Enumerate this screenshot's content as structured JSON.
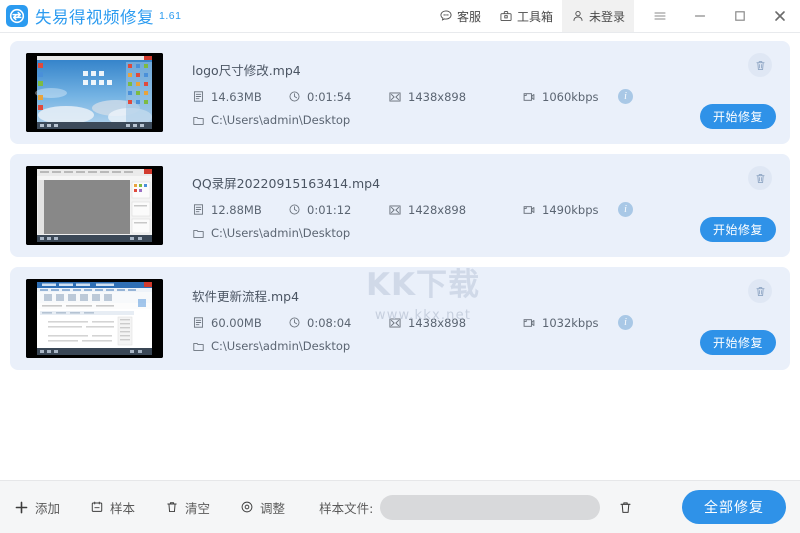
{
  "titlebar": {
    "logo_icon": "circular-arrow-logo",
    "app_name": "失易得视频修复",
    "version": "1.61",
    "actions": [
      {
        "icon": "chat-support-icon",
        "label": "客服",
        "highlight": false
      },
      {
        "icon": "toolbox-icon",
        "label": "工具箱",
        "highlight": false
      },
      {
        "icon": "user-icon",
        "label": "未登录",
        "highlight": true
      }
    ],
    "window_controls": [
      {
        "icon": "hamburger-menu-icon",
        "name": "menu"
      },
      {
        "icon": "minimize-icon",
        "name": "minimize"
      },
      {
        "icon": "maximize-icon",
        "name": "maximize"
      },
      {
        "icon": "close-icon",
        "name": "close"
      }
    ]
  },
  "watermark": {
    "main": "KK下载",
    "sub": "www.kkx.net"
  },
  "list": {
    "delete_icon": "trash-icon",
    "info_icon": "info-icon",
    "size_icon": "file-size-icon",
    "duration_icon": "clock-icon",
    "resolution_icon": "resolution-icon",
    "bitrate_icon": "video-bitrate-icon",
    "folder_icon": "folder-icon",
    "repair_label": "开始修复",
    "items": [
      {
        "filename": "logo尺寸修改.mp4",
        "size": "14.63MB",
        "duration": "0:01:54",
        "resolution": "1438x898",
        "bitrate": "1060kbps",
        "path": "C:\\Users\\admin\\Desktop",
        "thumb": "desktop-sky-wallpaper"
      },
      {
        "filename": "QQ录屏20220915163414.mp4",
        "size": "12.88MB",
        "duration": "0:01:12",
        "resolution": "1428x898",
        "bitrate": "1490kbps",
        "path": "C:\\Users\\admin\\Desktop",
        "thumb": "gray-application-window"
      },
      {
        "filename": "软件更新流程.mp4",
        "size": "60.00MB",
        "duration": "0:08:04",
        "resolution": "1438x898",
        "bitrate": "1032kbps",
        "path": "C:\\Users\\admin\\Desktop",
        "thumb": "document-editor-window"
      }
    ]
  },
  "footer": {
    "buttons": [
      {
        "icon": "plus-icon",
        "label": "添加"
      },
      {
        "icon": "sample-icon",
        "label": "样本"
      },
      {
        "icon": "trash-icon",
        "label": "清空"
      },
      {
        "icon": "adjust-icon",
        "label": "调整"
      }
    ],
    "sample_file_label": "样本文件:",
    "sample_file_value": "",
    "sample_file_placeholder": "",
    "sample_delete_icon": "trash-icon",
    "fix_all_label": "全部修复"
  },
  "colors": {
    "accent": "#2f92e8",
    "brand": "#2b9bf0",
    "card_bg": "#eaf0fa",
    "footer_bg": "#f5f6f7"
  }
}
